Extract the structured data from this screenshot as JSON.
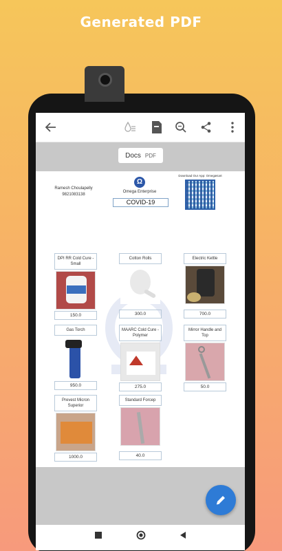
{
  "headline": "Generated PDF",
  "toolbar": {
    "back_icon": "arrow-left-icon",
    "icons": [
      "water-drop-icon",
      "document-icon",
      "zoom-icon",
      "share-icon",
      "more-vert-icon"
    ]
  },
  "toggle": {
    "docs": "Docs",
    "pdf": "PDF"
  },
  "header": {
    "name": "Ramesh Choulapelly",
    "phone": "9821083138",
    "enterprise": "Omega Enterprise",
    "title": "COVID-19",
    "download_text": "Download Our App: OmegaKart"
  },
  "products": [
    {
      "name": "DPI RR Cold Cure - Small",
      "price": "150.0"
    },
    {
      "name": "Cotton Rolls",
      "price": "300.0"
    },
    {
      "name": "Electric Kettle",
      "price": "700.0"
    },
    {
      "name": "Gas Torch",
      "price": "950.0"
    },
    {
      "name": "MAARC Cold Cure - Polymer",
      "price": "275.0"
    },
    {
      "name": "Mirror Handle and Top",
      "price": "50.0"
    },
    {
      "name": "Prevest Micron Superior",
      "price": "1000.0"
    },
    {
      "name": "Standard Forcep",
      "price": "40.0"
    }
  ],
  "colors": {
    "accent": "#2e7bd6",
    "logo": "#2c57a8"
  }
}
